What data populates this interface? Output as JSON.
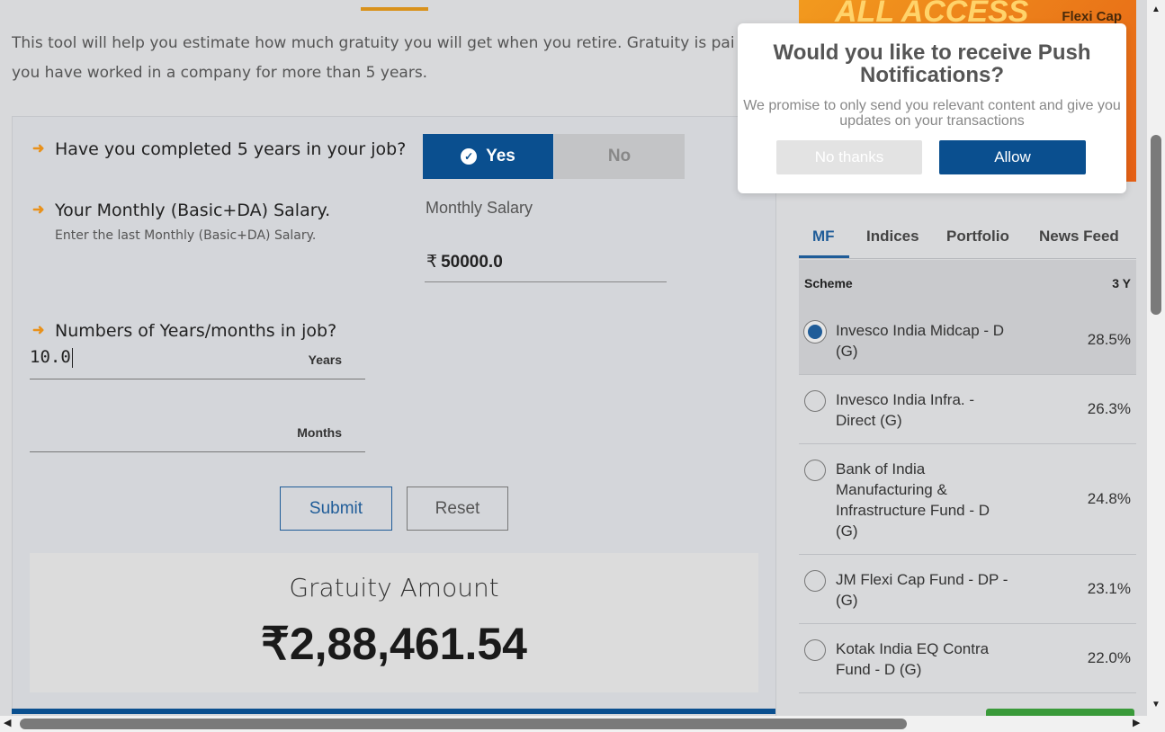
{
  "intro": "This tool will help you estimate how much gratuity you will get when you retire. Gratuity is paid when you have worked in a company for more than 5 years.",
  "intro_line1": "This tool will help you estimate how much gratuity you will get when you retire. Gratuity is pai",
  "intro_line2": "you have worked in a company for more than 5 years.",
  "form": {
    "q1": "Have you completed 5 years in your job?",
    "yes_label": "Yes",
    "no_label": "No",
    "q2": "Your Monthly (Basic+DA) Salary.",
    "q2_hint": "Enter the last Monthly (Basic+DA) Salary.",
    "salary_label": "Monthly Salary",
    "salary_currency": "₹",
    "salary_value": "50000.0",
    "q3": "Numbers of Years/months in job?",
    "years_value": "10.0",
    "years_unit": "Years",
    "months_value": "",
    "months_unit": "Months",
    "submit_label": "Submit",
    "reset_label": "Reset"
  },
  "result": {
    "title": "Gratuity Amount",
    "amount": "₹2,88,461.54"
  },
  "ad": {
    "text1": "ALL ACCESS",
    "text2": "Flexi Cap"
  },
  "tabs": [
    {
      "label": "MF",
      "active": true
    },
    {
      "label": "Indices",
      "active": false
    },
    {
      "label": "Portfolio",
      "active": false
    },
    {
      "label": "News Feed",
      "active": false
    }
  ],
  "table": {
    "col_scheme": "Scheme",
    "col_period": "3 Y",
    "rows": [
      {
        "name": "Invesco India Midcap - D (G)",
        "value": "28.5%",
        "selected": true
      },
      {
        "name": "Invesco India Infra. - Direct (G)",
        "value": "26.3%",
        "selected": false
      },
      {
        "name": "Bank of India Manufacturing & Infrastructure Fund - D (G)",
        "value": "24.8%",
        "selected": false
      },
      {
        "name": "JM Flexi Cap Fund - DP - (G)",
        "value": "23.1%",
        "selected": false
      },
      {
        "name": "Kotak India EQ Contra Fund - D (G)",
        "value": "22.0%",
        "selected": false
      }
    ]
  },
  "push_modal": {
    "title": "Would you like to receive Push Notifications?",
    "subtitle": "We promise to only send you relevant content and give you updates on your transactions",
    "no_thanks": "No thanks",
    "allow": "Allow"
  },
  "colors": {
    "brand_blue": "#0a4f8f",
    "accent_orange": "#e8911b"
  }
}
